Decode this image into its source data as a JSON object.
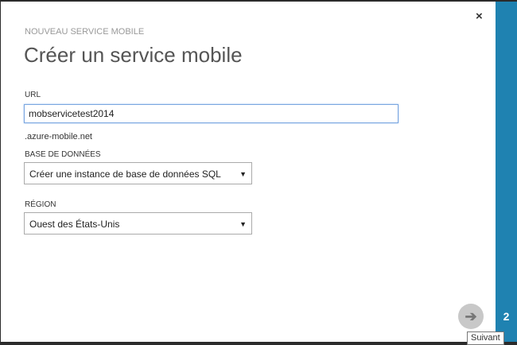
{
  "dialog": {
    "subtitle": "NOUVEAU SERVICE MOBILE",
    "title": "Créer un service mobile",
    "close_icon": "×"
  },
  "form": {
    "url_label": "URL",
    "url_value": "mobservicetest2014",
    "url_suffix": ".azure-mobile.net",
    "database_label": "BASE DE DONNÉES",
    "database_value": "Créer une instance de base de données SQL",
    "region_label": "RÉGION",
    "region_value": "Ouest des États-Unis",
    "dropdown_arrow": "▼"
  },
  "footer": {
    "next_icon": "➔",
    "next_tooltip": "Suivant",
    "step_number": "2"
  },
  "colors": {
    "accent": "#1f82b1"
  }
}
